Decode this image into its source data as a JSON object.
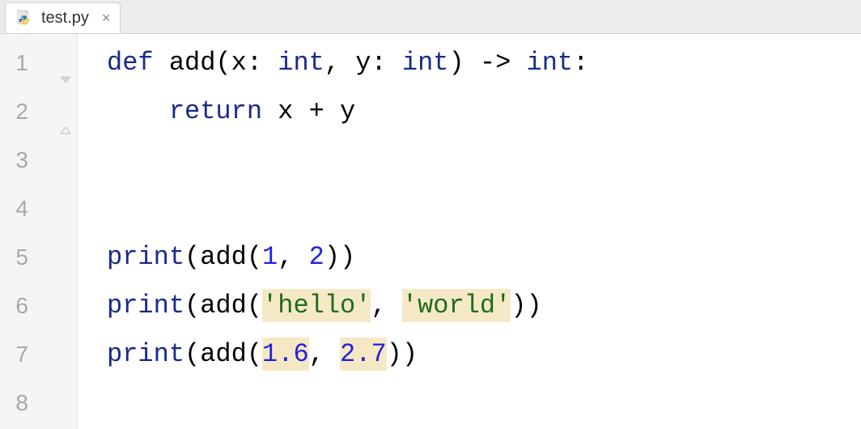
{
  "tab": {
    "filename": "test.py",
    "close_label": "×"
  },
  "lines": {
    "l1": "1",
    "l2": "2",
    "l3": "3",
    "l4": "4",
    "l5": "5",
    "l6": "6",
    "l7": "7",
    "l8": "8"
  },
  "code": {
    "l1": {
      "kw_def": "def",
      "sp1": " ",
      "fn": "add",
      "p1": "(x: ",
      "kw_int1": "int",
      "p2": ", y: ",
      "kw_int2": "int",
      "p3": ") -> ",
      "kw_int3": "int",
      "p4": ":"
    },
    "l2": {
      "indent": "    ",
      "kw_return": "return",
      "rest": " x + y"
    },
    "l3": {
      "blank": ""
    },
    "l4": {
      "blank": ""
    },
    "l5": {
      "builtin_print": "print",
      "p1": "(add(",
      "n1": "1",
      "p2": ", ",
      "n2": "2",
      "p3": "))"
    },
    "l6": {
      "builtin_print": "print",
      "p1": "(add(",
      "s1": "'hello'",
      "p2": ", ",
      "s2": "'world'",
      "p3": "))"
    },
    "l7": {
      "builtin_print": "print",
      "p1": "(add(",
      "n1": "1.6",
      "p2": ", ",
      "n2": "2.7",
      "p3": "))"
    },
    "l8": {
      "blank": ""
    }
  }
}
